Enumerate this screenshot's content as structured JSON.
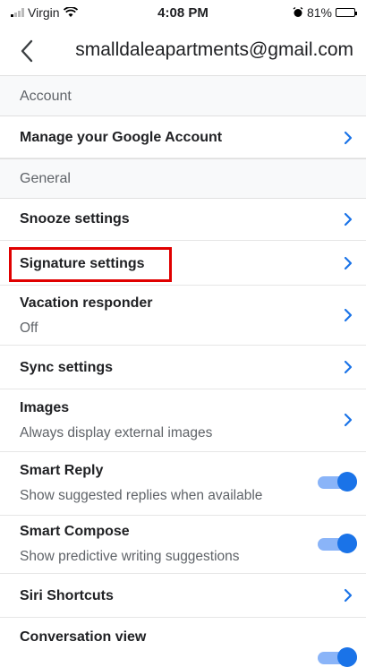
{
  "status_bar": {
    "carrier": "Virgin",
    "time": "4:08 PM",
    "battery": "81%",
    "battery_level": 0.81
  },
  "header": {
    "title": "smalldaleapartments@gmail.com"
  },
  "sections": {
    "account": "Account",
    "general": "General"
  },
  "rows": {
    "manage_account": {
      "label": "Manage your Google Account"
    },
    "snooze": {
      "label": "Snooze settings"
    },
    "signature": {
      "label": "Signature settings"
    },
    "vacation": {
      "label": "Vacation responder",
      "sub": "Off"
    },
    "sync": {
      "label": "Sync settings"
    },
    "images": {
      "label": "Images",
      "sub": "Always display external images"
    },
    "smart_reply": {
      "label": "Smart Reply",
      "sub": "Show suggested replies when available",
      "enabled": true
    },
    "smart_compose": {
      "label": "Smart Compose",
      "sub": "Show predictive writing suggestions",
      "enabled": true
    },
    "siri": {
      "label": "Siri Shortcuts"
    },
    "conversation": {
      "label": "Conversation view",
      "enabled": true
    }
  },
  "colors": {
    "accent": "#1a73e8",
    "highlight": "#e00000"
  }
}
